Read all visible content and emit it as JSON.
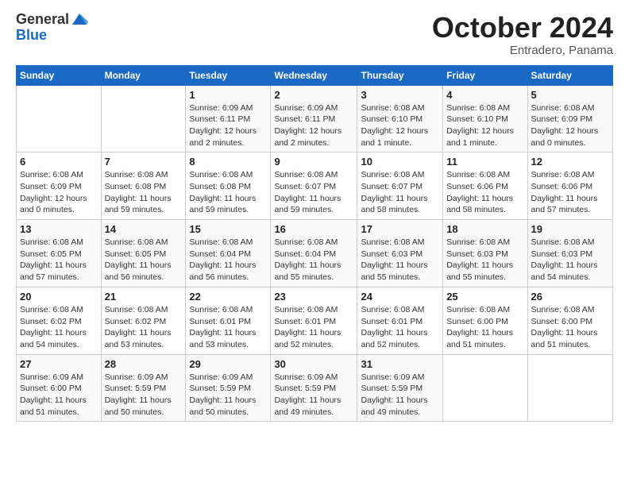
{
  "logo": {
    "general": "General",
    "blue": "Blue"
  },
  "title": "October 2024",
  "subtitle": "Entradero, Panama",
  "days_of_week": [
    "Sunday",
    "Monday",
    "Tuesday",
    "Wednesday",
    "Thursday",
    "Friday",
    "Saturday"
  ],
  "weeks": [
    [
      {
        "day": "",
        "detail": ""
      },
      {
        "day": "",
        "detail": ""
      },
      {
        "day": "1",
        "detail": "Sunrise: 6:09 AM\nSunset: 6:11 PM\nDaylight: 12 hours and 2 minutes."
      },
      {
        "day": "2",
        "detail": "Sunrise: 6:09 AM\nSunset: 6:11 PM\nDaylight: 12 hours and 2 minutes."
      },
      {
        "day": "3",
        "detail": "Sunrise: 6:08 AM\nSunset: 6:10 PM\nDaylight: 12 hours and 1 minute."
      },
      {
        "day": "4",
        "detail": "Sunrise: 6:08 AM\nSunset: 6:10 PM\nDaylight: 12 hours and 1 minute."
      },
      {
        "day": "5",
        "detail": "Sunrise: 6:08 AM\nSunset: 6:09 PM\nDaylight: 12 hours and 0 minutes."
      }
    ],
    [
      {
        "day": "6",
        "detail": "Sunrise: 6:08 AM\nSunset: 6:09 PM\nDaylight: 12 hours and 0 minutes."
      },
      {
        "day": "7",
        "detail": "Sunrise: 6:08 AM\nSunset: 6:08 PM\nDaylight: 11 hours and 59 minutes."
      },
      {
        "day": "8",
        "detail": "Sunrise: 6:08 AM\nSunset: 6:08 PM\nDaylight: 11 hours and 59 minutes."
      },
      {
        "day": "9",
        "detail": "Sunrise: 6:08 AM\nSunset: 6:07 PM\nDaylight: 11 hours and 59 minutes."
      },
      {
        "day": "10",
        "detail": "Sunrise: 6:08 AM\nSunset: 6:07 PM\nDaylight: 11 hours and 58 minutes."
      },
      {
        "day": "11",
        "detail": "Sunrise: 6:08 AM\nSunset: 6:06 PM\nDaylight: 11 hours and 58 minutes."
      },
      {
        "day": "12",
        "detail": "Sunrise: 6:08 AM\nSunset: 6:06 PM\nDaylight: 11 hours and 57 minutes."
      }
    ],
    [
      {
        "day": "13",
        "detail": "Sunrise: 6:08 AM\nSunset: 6:05 PM\nDaylight: 11 hours and 57 minutes."
      },
      {
        "day": "14",
        "detail": "Sunrise: 6:08 AM\nSunset: 6:05 PM\nDaylight: 11 hours and 56 minutes."
      },
      {
        "day": "15",
        "detail": "Sunrise: 6:08 AM\nSunset: 6:04 PM\nDaylight: 11 hours and 56 minutes."
      },
      {
        "day": "16",
        "detail": "Sunrise: 6:08 AM\nSunset: 6:04 PM\nDaylight: 11 hours and 55 minutes."
      },
      {
        "day": "17",
        "detail": "Sunrise: 6:08 AM\nSunset: 6:03 PM\nDaylight: 11 hours and 55 minutes."
      },
      {
        "day": "18",
        "detail": "Sunrise: 6:08 AM\nSunset: 6:03 PM\nDaylight: 11 hours and 55 minutes."
      },
      {
        "day": "19",
        "detail": "Sunrise: 6:08 AM\nSunset: 6:03 PM\nDaylight: 11 hours and 54 minutes."
      }
    ],
    [
      {
        "day": "20",
        "detail": "Sunrise: 6:08 AM\nSunset: 6:02 PM\nDaylight: 11 hours and 54 minutes."
      },
      {
        "day": "21",
        "detail": "Sunrise: 6:08 AM\nSunset: 6:02 PM\nDaylight: 11 hours and 53 minutes."
      },
      {
        "day": "22",
        "detail": "Sunrise: 6:08 AM\nSunset: 6:01 PM\nDaylight: 11 hours and 53 minutes."
      },
      {
        "day": "23",
        "detail": "Sunrise: 6:08 AM\nSunset: 6:01 PM\nDaylight: 11 hours and 52 minutes."
      },
      {
        "day": "24",
        "detail": "Sunrise: 6:08 AM\nSunset: 6:01 PM\nDaylight: 11 hours and 52 minutes."
      },
      {
        "day": "25",
        "detail": "Sunrise: 6:08 AM\nSunset: 6:00 PM\nDaylight: 11 hours and 51 minutes."
      },
      {
        "day": "26",
        "detail": "Sunrise: 6:08 AM\nSunset: 6:00 PM\nDaylight: 11 hours and 51 minutes."
      }
    ],
    [
      {
        "day": "27",
        "detail": "Sunrise: 6:09 AM\nSunset: 6:00 PM\nDaylight: 11 hours and 51 minutes."
      },
      {
        "day": "28",
        "detail": "Sunrise: 6:09 AM\nSunset: 5:59 PM\nDaylight: 11 hours and 50 minutes."
      },
      {
        "day": "29",
        "detail": "Sunrise: 6:09 AM\nSunset: 5:59 PM\nDaylight: 11 hours and 50 minutes."
      },
      {
        "day": "30",
        "detail": "Sunrise: 6:09 AM\nSunset: 5:59 PM\nDaylight: 11 hours and 49 minutes."
      },
      {
        "day": "31",
        "detail": "Sunrise: 6:09 AM\nSunset: 5:59 PM\nDaylight: 11 hours and 49 minutes."
      },
      {
        "day": "",
        "detail": ""
      },
      {
        "day": "",
        "detail": ""
      }
    ]
  ]
}
